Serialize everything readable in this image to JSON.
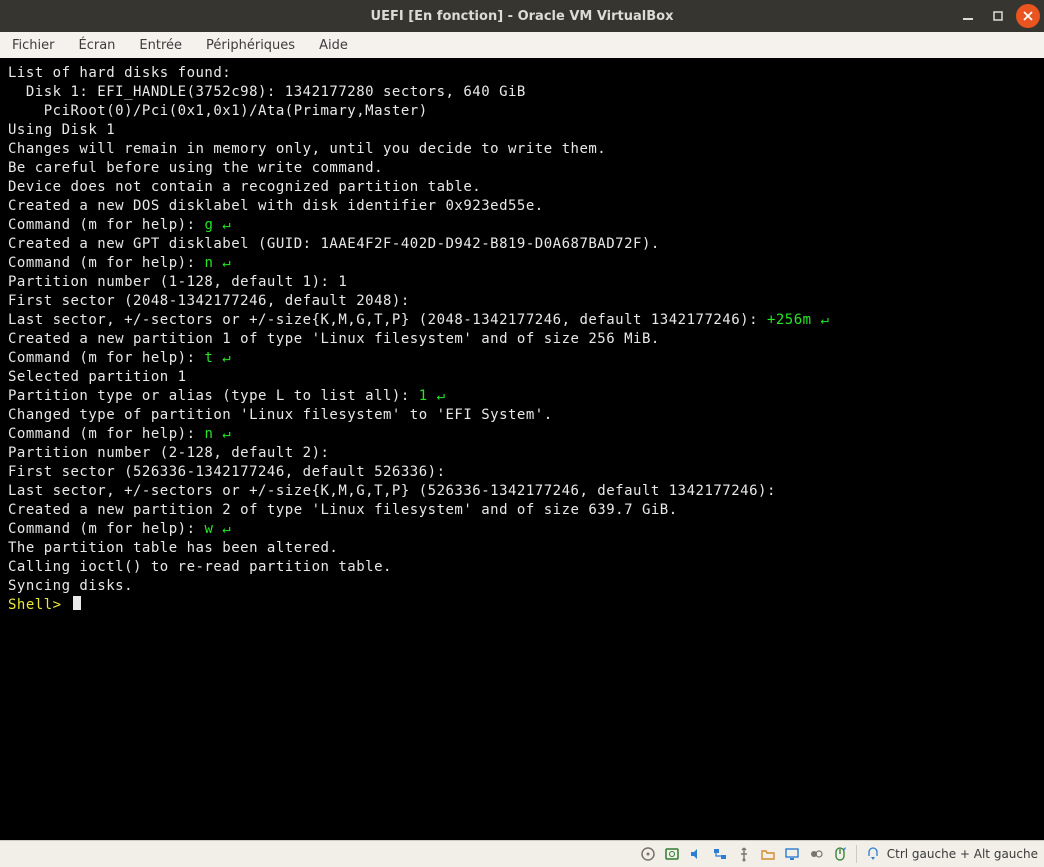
{
  "titlebar": {
    "title": "UEFI [En fonction] - Oracle VM VirtualBox"
  },
  "menubar": {
    "items": [
      "Fichier",
      "Écran",
      "Entrée",
      "Périphériques",
      "Aide"
    ]
  },
  "terminal": {
    "lines": [
      {
        "segs": [
          {
            "t": "List of hard disks found:"
          }
        ]
      },
      {
        "segs": [
          {
            "t": "  Disk 1: EFI_HANDLE(3752c98): 1342177280 sectors, 640 GiB"
          }
        ]
      },
      {
        "segs": [
          {
            "t": "    PciRoot(0)/Pci(0x1,0x1)/Ata(Primary,Master)"
          }
        ]
      },
      {
        "segs": [
          {
            "t": ""
          }
        ]
      },
      {
        "segs": [
          {
            "t": "Using Disk 1"
          }
        ]
      },
      {
        "segs": [
          {
            "t": ""
          }
        ]
      },
      {
        "segs": [
          {
            "t": "Changes will remain in memory only, until you decide to write them."
          }
        ]
      },
      {
        "segs": [
          {
            "t": "Be careful before using the write command."
          }
        ]
      },
      {
        "segs": [
          {
            "t": ""
          }
        ]
      },
      {
        "segs": [
          {
            "t": "Device does not contain a recognized partition table."
          }
        ]
      },
      {
        "segs": [
          {
            "t": "Created a new DOS disklabel with disk identifier 0x923ed55e."
          }
        ]
      },
      {
        "segs": [
          {
            "t": ""
          }
        ]
      },
      {
        "segs": [
          {
            "t": "Command (m for help): "
          },
          {
            "t": "g ",
            "c": "grn"
          },
          {
            "t": "↵",
            "c": "grn"
          }
        ]
      },
      {
        "segs": [
          {
            "t": "Created a new GPT disklabel (GUID: 1AAE4F2F-402D-D942-B819-D0A687BAD72F)."
          }
        ]
      },
      {
        "segs": [
          {
            "t": ""
          }
        ]
      },
      {
        "segs": [
          {
            "t": "Command (m for help): "
          },
          {
            "t": "n ",
            "c": "grn"
          },
          {
            "t": "↵",
            "c": "grn"
          }
        ]
      },
      {
        "segs": [
          {
            "t": "Partition number (1-128, default 1): 1"
          }
        ]
      },
      {
        "segs": [
          {
            "t": "First sector (2048-1342177246, default 2048):"
          }
        ]
      },
      {
        "segs": [
          {
            "t": "Last sector, +/-sectors or +/-size{K,M,G,T,P} (2048-1342177246, default 1342177246): "
          },
          {
            "t": "+256m ",
            "c": "grn"
          },
          {
            "t": "↵",
            "c": "grn"
          }
        ]
      },
      {
        "segs": [
          {
            "t": ""
          }
        ]
      },
      {
        "segs": [
          {
            "t": "Created a new partition 1 of type 'Linux filesystem' and of size 256 MiB."
          }
        ]
      },
      {
        "segs": [
          {
            "t": ""
          }
        ]
      },
      {
        "segs": [
          {
            "t": "Command (m for help): "
          },
          {
            "t": "t ",
            "c": "grn"
          },
          {
            "t": "↵",
            "c": "grn"
          }
        ]
      },
      {
        "segs": [
          {
            "t": "Selected partition 1"
          }
        ]
      },
      {
        "segs": [
          {
            "t": "Partition type or alias (type L to list all): "
          },
          {
            "t": "1 ",
            "c": "grn"
          },
          {
            "t": "↵",
            "c": "grn"
          }
        ]
      },
      {
        "segs": [
          {
            "t": "Changed type of partition 'Linux filesystem' to 'EFI System'."
          }
        ]
      },
      {
        "segs": [
          {
            "t": ""
          }
        ]
      },
      {
        "segs": [
          {
            "t": "Command (m for help): "
          },
          {
            "t": "n ",
            "c": "grn"
          },
          {
            "t": "↵",
            "c": "grn"
          }
        ]
      },
      {
        "segs": [
          {
            "t": "Partition number (2-128, default 2):"
          }
        ]
      },
      {
        "segs": [
          {
            "t": "First sector (526336-1342177246, default 526336):"
          }
        ]
      },
      {
        "segs": [
          {
            "t": "Last sector, +/-sectors or +/-size{K,M,G,T,P} (526336-1342177246, default 1342177246):"
          }
        ]
      },
      {
        "segs": [
          {
            "t": ""
          }
        ]
      },
      {
        "segs": [
          {
            "t": "Created a new partition 2 of type 'Linux filesystem' and of size 639.7 GiB."
          }
        ]
      },
      {
        "segs": [
          {
            "t": ""
          }
        ]
      },
      {
        "segs": [
          {
            "t": "Command (m for help): "
          },
          {
            "t": "w ",
            "c": "grn"
          },
          {
            "t": "↵",
            "c": "grn"
          }
        ]
      },
      {
        "segs": [
          {
            "t": "The partition table has been altered."
          }
        ]
      },
      {
        "segs": [
          {
            "t": "Calling ioctl() to re-read partition table."
          }
        ]
      },
      {
        "segs": [
          {
            "t": "Syncing disks."
          }
        ]
      },
      {
        "segs": [
          {
            "t": ""
          }
        ]
      },
      {
        "segs": [
          {
            "t": "Shell> ",
            "c": "yel"
          }
        ],
        "cursor": true
      }
    ]
  },
  "statusbar": {
    "icons": [
      "optical-disk-icon",
      "hard-disk-icon",
      "audio-icon",
      "network-icon",
      "usb-icon",
      "shared-folder-icon",
      "display-icon",
      "recording-icon",
      "mouse-integration-icon",
      "keyboard-icon"
    ],
    "host_key": "Ctrl gauche + Alt gauche"
  }
}
